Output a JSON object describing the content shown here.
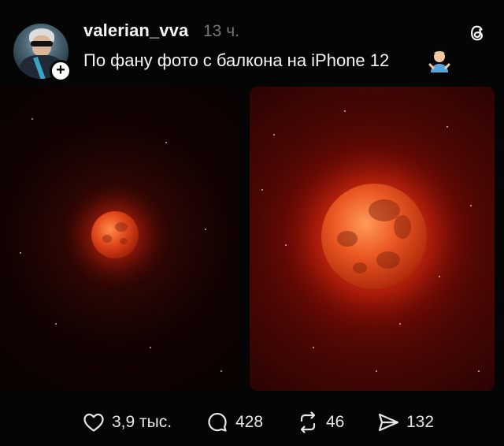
{
  "post": {
    "username": "valerian_vva",
    "timestamp": "13 ч.",
    "caption": "По фану фото с балкона на iPhone 12",
    "caption_emoji": "person-shrugging-emoji",
    "follow_icon": "plus-icon",
    "app_icon": "threads-logo-icon"
  },
  "photos": [
    {
      "name": "blood-moon-photo-small"
    },
    {
      "name": "blood-moon-photo-large"
    }
  ],
  "actions": {
    "likes": "3,9 тыс.",
    "replies": "428",
    "reposts": "46",
    "shares": "132",
    "icons": [
      "heart-icon",
      "reply-icon",
      "repost-icon",
      "share-icon"
    ]
  },
  "colors": {
    "background": "#050505",
    "text": "#f3f5f7",
    "muted": "#777777",
    "moon_red": "#e0461a"
  }
}
